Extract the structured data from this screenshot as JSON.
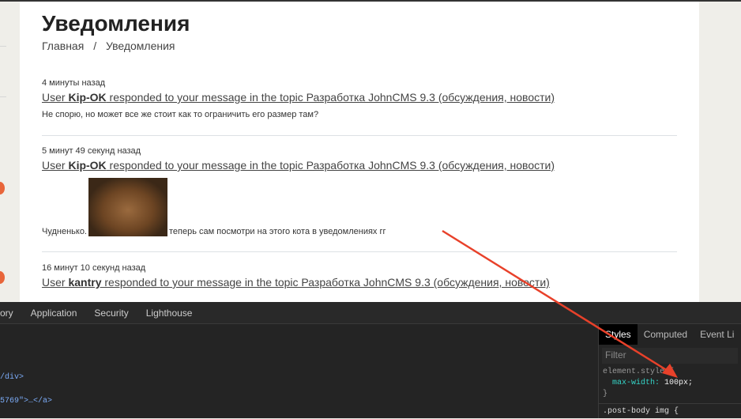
{
  "page": {
    "title": "Уведомления",
    "breadcrumb": [
      "Главная",
      "/",
      "Уведомления"
    ]
  },
  "notifications": [
    {
      "time": "4 минуты назад",
      "pre": "User ",
      "user": "Kip-OK",
      "post": " responded to your message in the topic Разработка JohnCMS 9.3 (обсуждения, новости)",
      "text": "Не спорю, но может все же стоит как то ограничить его размер там?"
    },
    {
      "time": "5 минут 49 секунд назад",
      "pre": "User ",
      "user": "Kip-OK",
      "post": " responded to your message in the topic Разработка JohnCMS 9.3 (обсуждения, новости)",
      "text_before": "Чудненько.",
      "text_after": "теперь сам посмотри на этого кота в уведомлениях гг"
    },
    {
      "time": "16 минут 10 секунд назад",
      "pre": "User ",
      "user": "kantry",
      "post": " responded to your message in the topic Разработка JohnCMS 9.3 (обсуждения, новости)"
    }
  ],
  "devtools": {
    "tabs": [
      "ory",
      "Application",
      "Security",
      "Lighthouse"
    ],
    "code": [
      "/div>",
      "5769\">…</a>"
    ],
    "styles_tabs": [
      "Styles",
      "Computed",
      "Event Li"
    ],
    "filter_placeholder": "Filter",
    "element_style": "element.style {",
    "prop": "max-width",
    "value": "100px;",
    "close": "}",
    "next_rule": ".post-body img {"
  },
  "colors": {
    "accent": "#e8653a",
    "arrow": "#e8412a"
  }
}
